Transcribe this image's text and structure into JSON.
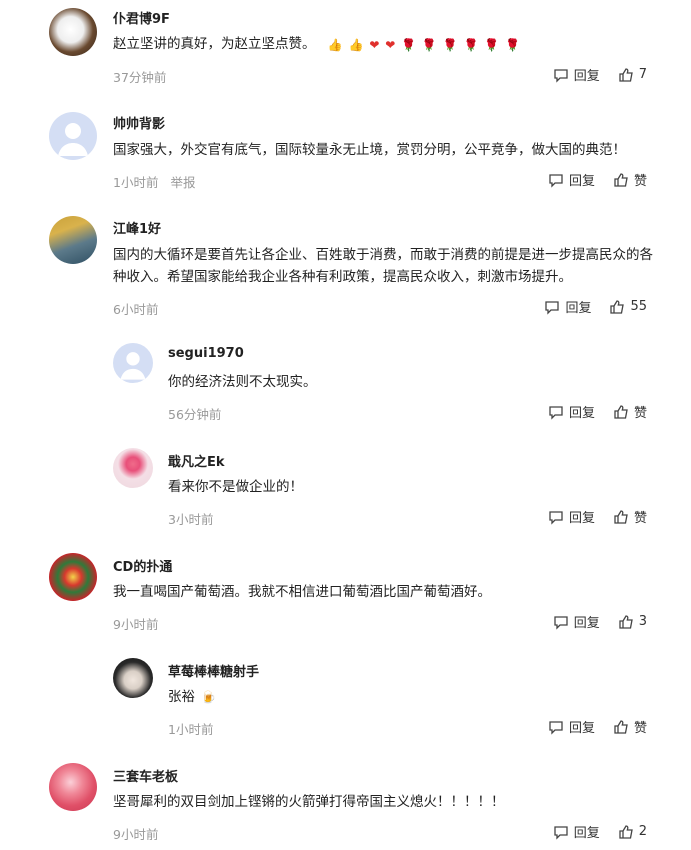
{
  "labels": {
    "reply": "回复",
    "like": "赞",
    "report": "举报"
  },
  "comments": [
    {
      "name": "仆君博9F",
      "text": "赵立坚讲的真好，为赵立坚点赞。",
      "emojis": [
        "👍",
        "👍",
        "❤",
        "❤",
        "🌹",
        "🌹",
        "🌹",
        "🌹",
        "🌹",
        "🌹"
      ],
      "time": "37分钟前",
      "likes": "7"
    },
    {
      "name": "帅帅背影",
      "text": "国家强大，外交官有底气，国际较量永无止境，赏罚分明，公平竞争，做大国的典范！",
      "time": "1小时前",
      "report": "举报",
      "likes": "赞"
    },
    {
      "name": "江峰1好",
      "text": "国内的大循环是要首先让各企业、百姓敢于消费，而敢于消费的前提是进一步提高民众的各种收入。希望国家能给我企业各种有利政策，提高民众收入，刺激市场提升。",
      "time": "6小时前",
      "likes": "55"
    },
    {
      "name": "segui1970",
      "text": "你的经济法则不太现实。",
      "time": "56分钟前",
      "likes": "赞"
    },
    {
      "name": "戢凡之Ek",
      "text": "看来你不是做企业的！",
      "time": "3小时前",
      "likes": "赞"
    },
    {
      "name": "CD的扑通",
      "text": "我一直喝国产葡萄酒。我就不相信进口葡萄酒比国产葡萄酒好。",
      "time": "9小时前",
      "likes": "3"
    },
    {
      "name": "草莓棒棒糖射手",
      "text": "张裕",
      "emojis": [
        "🍺"
      ],
      "time": "1小时前",
      "likes": "赞"
    },
    {
      "name": "三套车老板",
      "text": "坚哥犀利的双目剑加上铿锵的火箭弹打得帝国主义熄火！！！！！",
      "time": "9小时前",
      "likes": "2"
    }
  ]
}
